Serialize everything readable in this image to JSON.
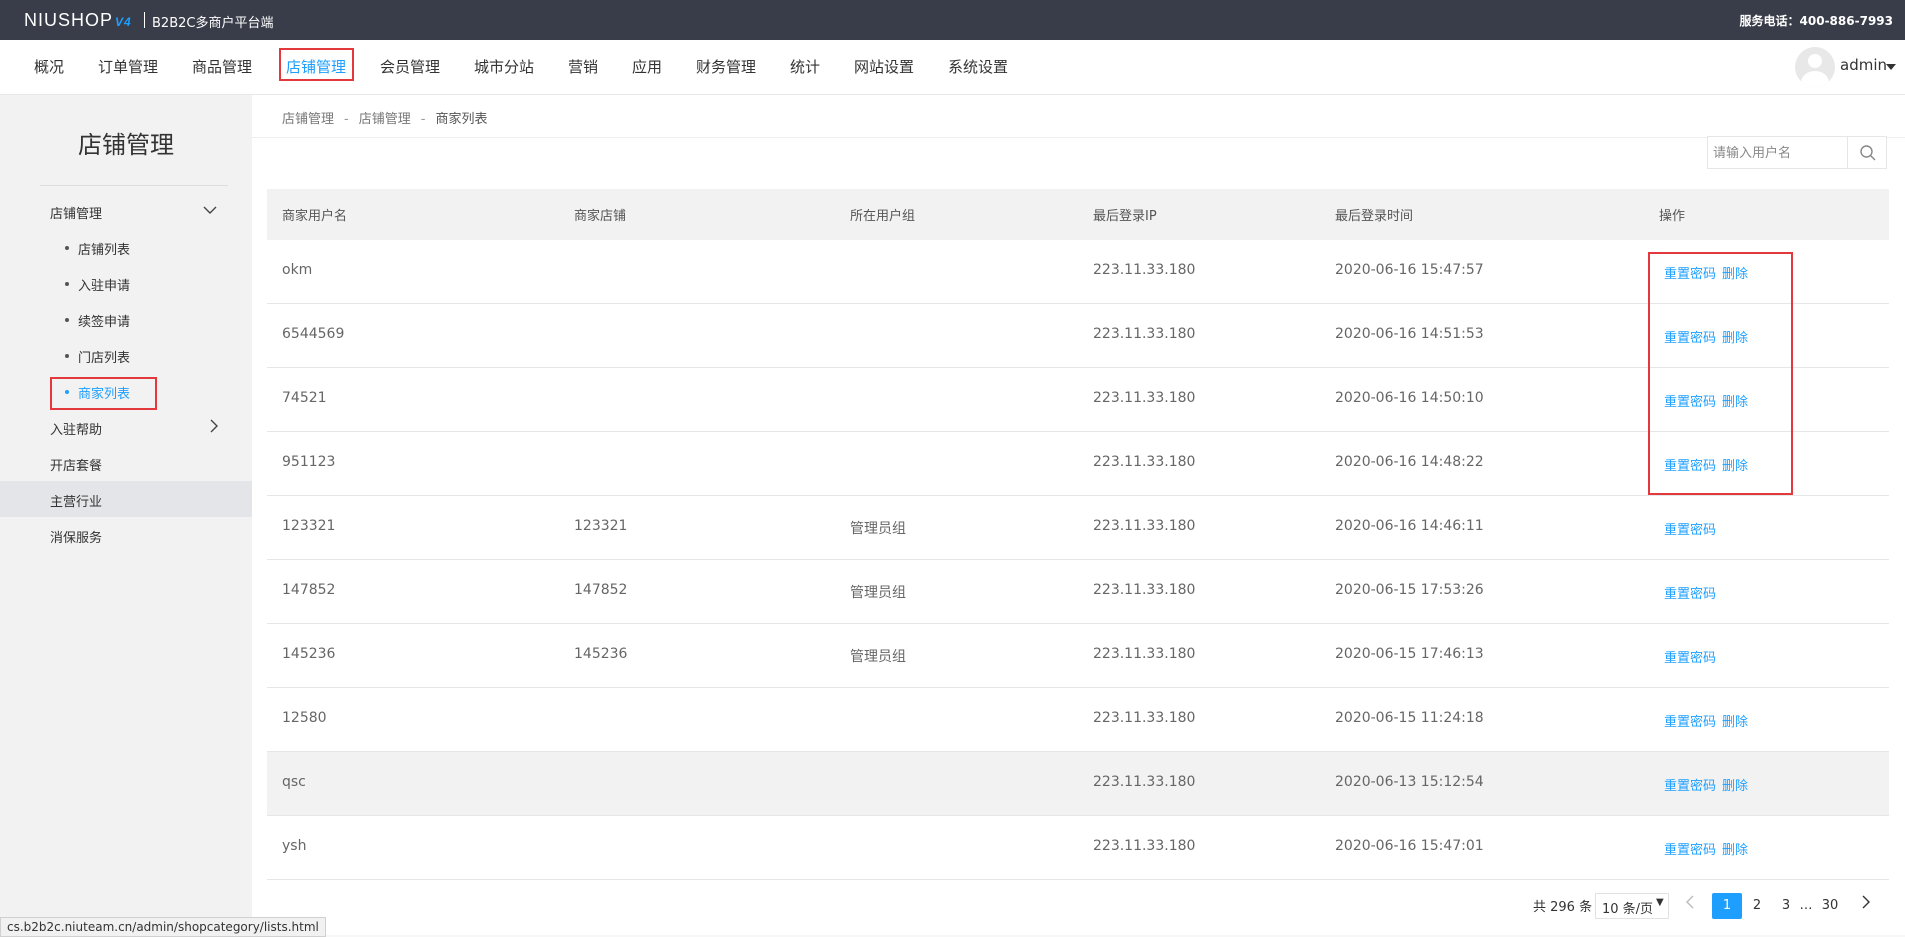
{
  "topbar": {
    "logo_text": "NIUSHOP",
    "logo_version": "V4",
    "subtitle": "B2B2C多商户平台端",
    "service_phone": "服务电话：400-886-7993"
  },
  "nav": {
    "items": [
      "概况",
      "订单管理",
      "商品管理",
      "店铺管理",
      "会员管理",
      "城市分站",
      "营销",
      "应用",
      "财务管理",
      "统计",
      "网站设置",
      "系统设置"
    ],
    "active_index": 3,
    "user_name": "admin"
  },
  "sidebar": {
    "title": "店铺管理",
    "group_label": "店铺管理",
    "sub_items": [
      "店铺列表",
      "入驻申请",
      "续签申请",
      "门店列表",
      "商家列表"
    ],
    "active_sub_index": 4,
    "items": [
      "入驻帮助",
      "开店套餐",
      "主营行业",
      "消保服务"
    ],
    "selected_item_index": 2
  },
  "breadcrumb": [
    "店铺管理",
    "店铺管理",
    "商家列表"
  ],
  "search": {
    "placeholder": "请输入用户名",
    "value": ""
  },
  "table": {
    "headers": [
      "商家用户名",
      "商家店铺",
      "所在用户组",
      "最后登录IP",
      "最后登录时间",
      "操作"
    ],
    "rows": [
      {
        "username": "okm",
        "shop": "",
        "group": "",
        "ip": "223.11.33.180",
        "time": "2020-06-16 15:47:57",
        "actions": [
          "重置密码",
          "删除"
        ]
      },
      {
        "username": "6544569",
        "shop": "",
        "group": "",
        "ip": "223.11.33.180",
        "time": "2020-06-16 14:51:53",
        "actions": [
          "重置密码",
          "删除"
        ]
      },
      {
        "username": "74521",
        "shop": "",
        "group": "",
        "ip": "223.11.33.180",
        "time": "2020-06-16 14:50:10",
        "actions": [
          "重置密码",
          "删除"
        ]
      },
      {
        "username": "951123",
        "shop": "",
        "group": "",
        "ip": "223.11.33.180",
        "time": "2020-06-16 14:48:22",
        "actions": [
          "重置密码",
          "删除"
        ]
      },
      {
        "username": "123321",
        "shop": "123321",
        "group": "管理员组",
        "ip": "223.11.33.180",
        "time": "2020-06-16 14:46:11",
        "actions": [
          "重置密码"
        ]
      },
      {
        "username": "147852",
        "shop": "147852",
        "group": "管理员组",
        "ip": "223.11.33.180",
        "time": "2020-06-15 17:53:26",
        "actions": [
          "重置密码"
        ]
      },
      {
        "username": "145236",
        "shop": "145236",
        "group": "管理员组",
        "ip": "223.11.33.180",
        "time": "2020-06-15 17:46:13",
        "actions": [
          "重置密码"
        ]
      },
      {
        "username": "12580",
        "shop": "",
        "group": "",
        "ip": "223.11.33.180",
        "time": "2020-06-15 11:24:18",
        "actions": [
          "重置密码",
          "删除"
        ]
      },
      {
        "username": "qsc",
        "shop": "",
        "group": "",
        "ip": "223.11.33.180",
        "time": "2020-06-13 15:12:54",
        "actions": [
          "重置密码",
          "删除"
        ]
      },
      {
        "username": "ysh",
        "shop": "",
        "group": "",
        "ip": "223.11.33.180",
        "time": "2020-06-16 15:47:01",
        "actions": [
          "重置密码",
          "删除"
        ]
      }
    ],
    "hover_row_index": 8
  },
  "pagination": {
    "total": "共 296 条",
    "page_size": "10 条/页",
    "pages": [
      "1",
      "2",
      "3",
      "…",
      "30"
    ],
    "current": "1"
  },
  "status_url": "cs.b2b2c.niuteam.cn/admin/shopcategory/lists.html",
  "colors": {
    "accent": "#1E9FFF",
    "topbar": "#393D49",
    "highlight": "#e4393c"
  }
}
